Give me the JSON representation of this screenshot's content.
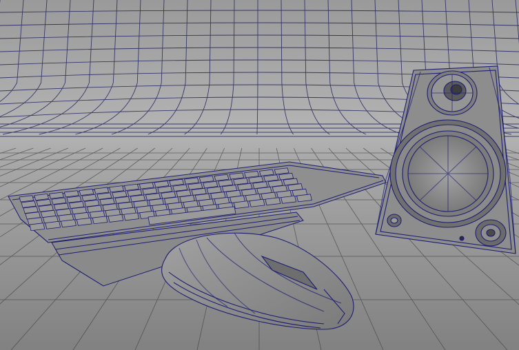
{
  "viewport": {
    "background_top": "#9d9d9d",
    "background_horizon": "#b3b3b3",
    "floor_color": "#878787",
    "wire_color": "#1c1c6e",
    "grid_color": "#3a3a3a",
    "model_fill": "#8e8e8e",
    "model_fill_dark": "#6d6d6d"
  },
  "objects": [
    {
      "name": "keyboard",
      "type": "wireframe-model"
    },
    {
      "name": "mouse",
      "type": "wireframe-model"
    },
    {
      "name": "speaker",
      "type": "wireframe-model"
    },
    {
      "name": "cyclorama-backdrop",
      "type": "wireframe-surface"
    },
    {
      "name": "floor-grid",
      "type": "grid"
    }
  ]
}
